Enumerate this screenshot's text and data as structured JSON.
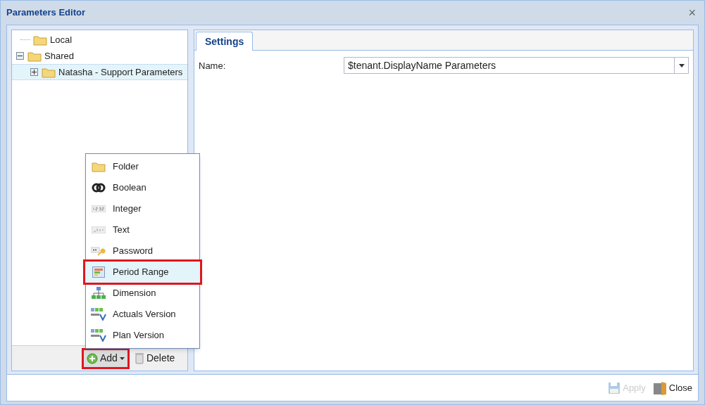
{
  "window": {
    "title": "Parameters Editor",
    "close_glyph": "×"
  },
  "tree": [
    {
      "label": "Local",
      "selected": false
    },
    {
      "label": "Shared",
      "expanded": true,
      "selected": false,
      "children": [
        {
          "label": "Natasha - Support Parameters",
          "expanded": false,
          "selected": true
        }
      ]
    }
  ],
  "tree_toolbar": [
    {
      "kind": "add",
      "label": "Add",
      "highlighted": true
    },
    {
      "kind": "delete",
      "label": "Delete",
      "highlighted": false
    }
  ],
  "add_menu": [
    {
      "kind": "folder",
      "label": "Folder",
      "highlighted": false
    },
    {
      "kind": "boolean",
      "label": "Boolean",
      "highlighted": false
    },
    {
      "kind": "integer",
      "label": "Integer",
      "highlighted": false
    },
    {
      "kind": "text",
      "label": "Text",
      "highlighted": false
    },
    {
      "kind": "password",
      "label": "Password",
      "highlighted": false
    },
    {
      "kind": "period",
      "label": "Period Range",
      "highlighted": true
    },
    {
      "kind": "dimension",
      "label": "Dimension",
      "highlighted": false
    },
    {
      "kind": "version",
      "label": "Actuals Version",
      "highlighted": false
    },
    {
      "kind": "version",
      "label": "Plan Version",
      "highlighted": false
    }
  ],
  "tabs": [
    {
      "label": "Settings",
      "selected": true
    }
  ],
  "form": {
    "label": "Name:",
    "value": "$tenant.DisplayName Parameters"
  },
  "buttons": [
    {
      "kind": "apply",
      "label": "Apply",
      "disabled": true
    },
    {
      "kind": "close",
      "label": "Close",
      "disabled": false
    }
  ]
}
